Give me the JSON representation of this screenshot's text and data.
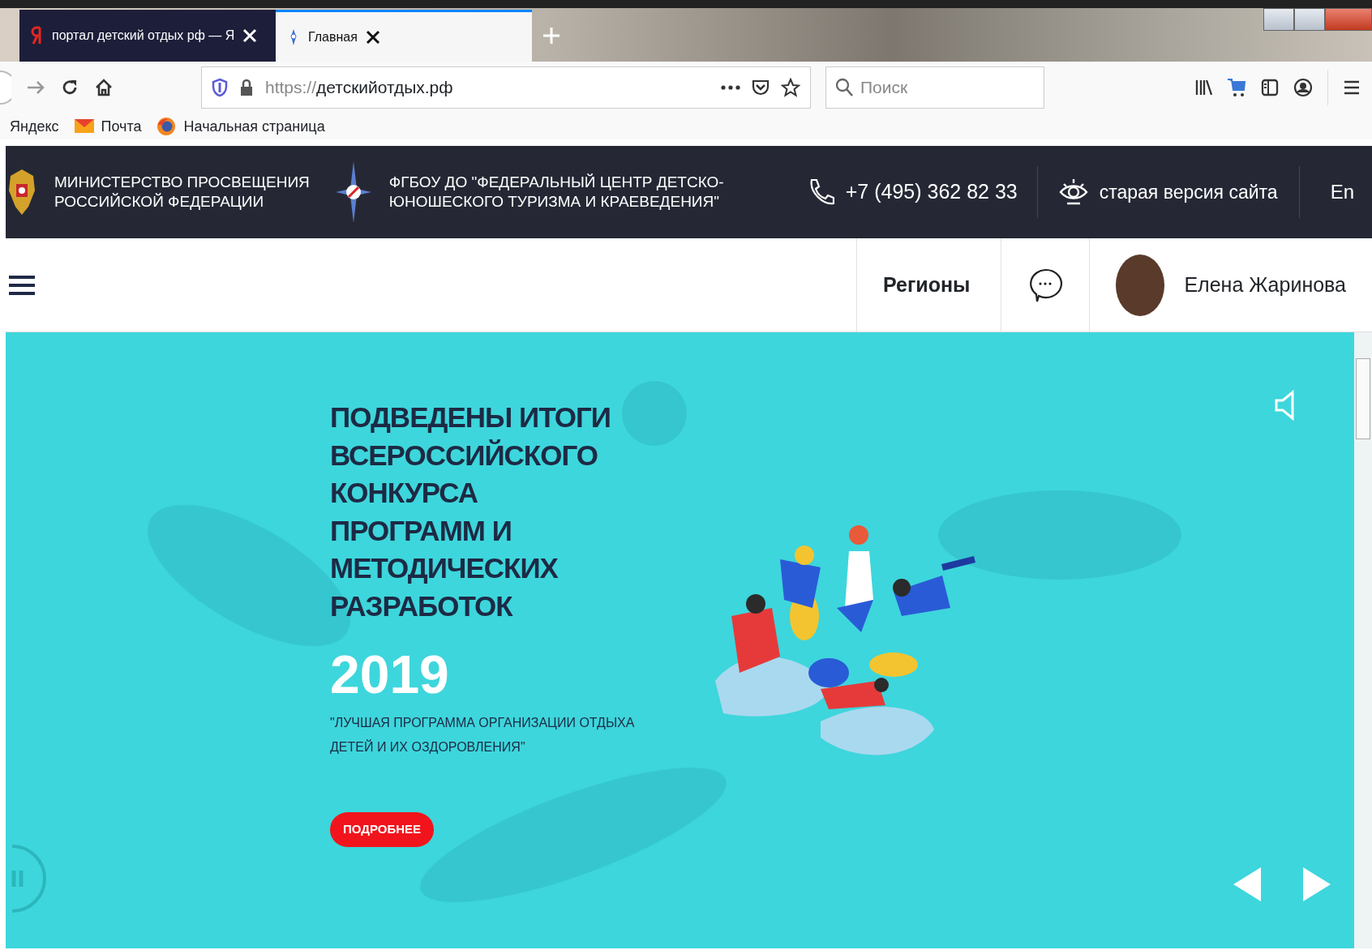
{
  "browser": {
    "tabs": [
      {
        "title": "портал детский отдых рф — Я",
        "selected": false,
        "kind": "yandex"
      },
      {
        "title": "Главная",
        "selected": true,
        "kind": "site"
      }
    ],
    "url": {
      "scheme": "https://",
      "host": "детскийотдых.рф"
    },
    "search": {
      "placeholder": "Поиск"
    },
    "bookmarks": [
      {
        "label": "Яндекс",
        "kind": "plain"
      },
      {
        "label": "Почта",
        "kind": "mail"
      },
      {
        "label": "Начальная страница",
        "kind": "firefox"
      }
    ]
  },
  "site": {
    "top_bar": {
      "ministry": "МИНИСТЕРСТВО ПРОСВЕЩЕНИЯ\nРОССИЙСКОЙ ФЕДЕРАЦИИ",
      "center": "ФГБОУ ДО \"ФЕДЕРАЛЬНЫЙ ЦЕНТР ДЕТСКО-\nЮНОШЕСКОГО ТУРИЗМА И КРАЕВЕДЕНИЯ\"",
      "phone": "+7 (495) 362 82 33",
      "old_version": "старая версия сайта",
      "language": "En"
    },
    "nav": {
      "regions": "Регионы",
      "user_name": "Елена Жаринова"
    },
    "hero": {
      "title": "ПОДВЕДЕНЫ ИТОГИ\nВСЕРОССИЙСКОГО\nКОНКУРСА\nПРОГРАММ И\nМЕТОДИЧЕСКИХ\nРАЗРАБОТОК",
      "year": "2019",
      "subtitle": "\"ЛУЧШАЯ ПРОГРАММА ОРГАНИЗАЦИИ ОТДЫХА\nДЕТЕЙ И ИХ ОЗДОРОВЛЕНИЯ\"",
      "button": "ПОДРОБНЕЕ"
    }
  }
}
